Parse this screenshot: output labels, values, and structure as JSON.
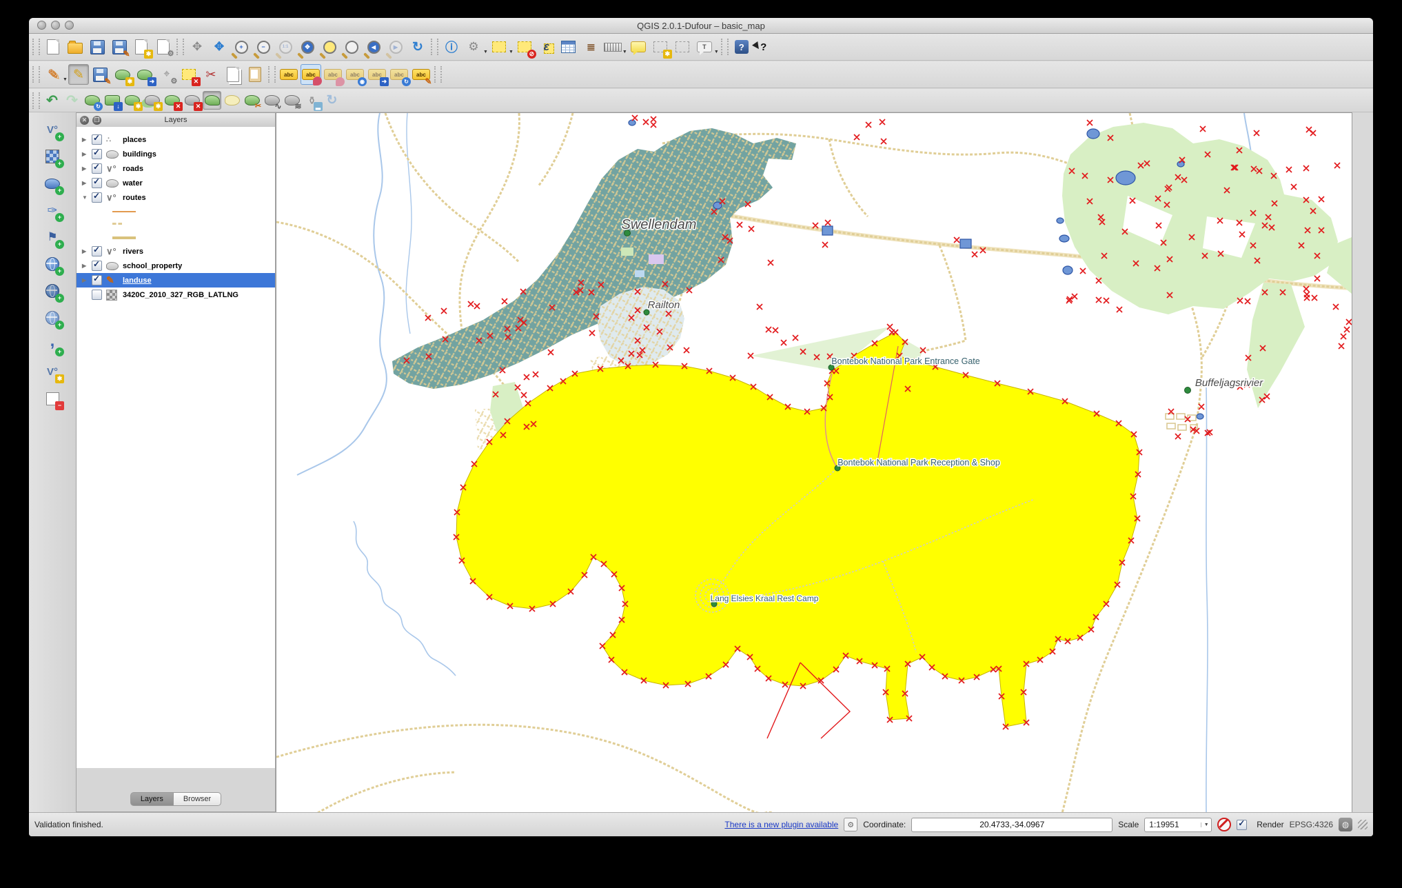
{
  "window": {
    "title": "QGIS 2.0.1-Dufour – basic_map"
  },
  "toolbar_glyphs": {
    "abc": "abc",
    "epsilon": "ε",
    "ratio": "1:1",
    "annotation_t": "T",
    "help": "?",
    "whats_this": "?"
  },
  "toolbars": {
    "file": [
      "new-project",
      "open-project",
      "save-project",
      "save-project-as",
      "new-print-composer",
      "composer-manager"
    ],
    "navigation": [
      "pan-map",
      "pan-to-selection",
      "zoom-in",
      "zoom-out",
      "zoom-actual-size",
      "zoom-full-extent",
      "zoom-to-selection",
      "zoom-to-layer",
      "zoom-last",
      "zoom-next",
      "refresh"
    ],
    "attributes": [
      "identify-features",
      "run-feature-action",
      "select-features",
      "deselect-features",
      "select-by-expression",
      "open-attribute-table",
      "field-calculator",
      "measure-line",
      "map-tips",
      "new-bookmark",
      "show-bookmarks",
      "text-annotation"
    ],
    "help": [
      "help-contents",
      "whats-this"
    ],
    "digitizing": [
      "current-edits",
      "toggle-editing",
      "save-layer-edits",
      "add-feature",
      "move-feature",
      "node-tool",
      "delete-selected",
      "cut-features",
      "copy-features",
      "paste-features"
    ],
    "labeling": [
      "layer-labeling-options",
      "pin-unpin-labels",
      "show-hide-pinned-labels",
      "show-hide-labels",
      "move-label",
      "rotate-label",
      "change-label-properties"
    ],
    "advanced_digitizing": [
      "undo",
      "redo",
      "rotate-feature",
      "simplify-feature",
      "add-ring",
      "add-part",
      "delete-ring",
      "delete-part",
      "reshape-features",
      "offset-curve",
      "split-features",
      "split-parts",
      "merge-selected-features",
      "merge-attributes",
      "rotate-point-symbols"
    ],
    "manage_layers": [
      "add-vector-layer",
      "add-raster-layer",
      "add-postgis-layer",
      "add-spatialite-layer",
      "add-mssql-layer",
      "add-wms-layer",
      "add-wcs-layer",
      "add-wfs-layer",
      "add-delimited-text-layer",
      "new-shapefile-layer",
      "remove-layer"
    ]
  },
  "layers_panel": {
    "title": "Layers",
    "items": [
      {
        "label": "places",
        "checked": true
      },
      {
        "label": "buildings",
        "checked": true
      },
      {
        "label": "roads",
        "checked": true
      },
      {
        "label": "water",
        "checked": true
      },
      {
        "label": "routes",
        "checked": true,
        "expanded": true
      },
      {
        "label": "rivers",
        "checked": true
      },
      {
        "label": "school_property",
        "checked": true
      },
      {
        "label": "landuse",
        "checked": true,
        "selected": true,
        "editing": true
      },
      {
        "label": "3420C_2010_327_RGB_LATLNG",
        "checked": false
      }
    ],
    "tabs": [
      {
        "label": "Layers",
        "active": true
      },
      {
        "label": "Browser",
        "active": false
      }
    ]
  },
  "map": {
    "labels": [
      {
        "text": "Swellendam"
      },
      {
        "text": "Railton"
      },
      {
        "text": "Bontebok National Park Entrance Gate"
      },
      {
        "text": "Bontebok National Park Reception & Shop"
      },
      {
        "text": "Lang Elsies Kraal Rest Camp"
      },
      {
        "text": "Buffeljagsrivier"
      }
    ]
  },
  "status_bar": {
    "message": "Validation finished.",
    "plugin_link": "There is a new plugin available",
    "coordinate_label": "Coordinate:",
    "coordinate_value": "20.4733,-34.0967",
    "scale_label": "Scale",
    "scale_value": "1:19951",
    "render_label": "Render",
    "crs_label": "EPSG:4326"
  },
  "colors": {
    "landuse_yellow": "#ffff00",
    "urban_teal": "#72a3a1",
    "parkland_green": "#d8efc4",
    "selection_blue": "#3d77d8",
    "vertex_marker_red": "#e2191c",
    "road_tan": "#e0ce96",
    "river_blue": "#a9c7ea",
    "water_fill": "#6f97d6"
  }
}
